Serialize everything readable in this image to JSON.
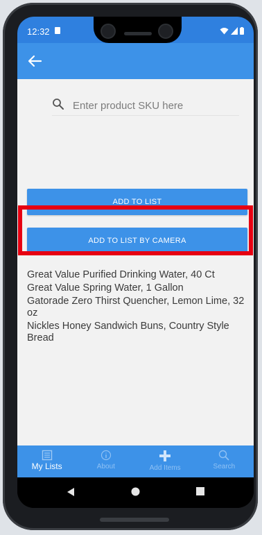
{
  "status": {
    "time": "12:32",
    "icons": [
      "wifi-icon",
      "signal-icon",
      "battery-icon"
    ]
  },
  "appbar": {
    "back_icon": "arrow-left-icon"
  },
  "search": {
    "placeholder": "Enter product SKU here",
    "value": ""
  },
  "buttons": {
    "add_to_list": "ADD TO LIST",
    "add_by_camera": "ADD TO LIST BY CAMERA"
  },
  "list_items": [
    "Great Value Purified Drinking Water, 40 Ct",
    "Great Value Spring Water, 1 Gallon",
    "Gatorade Zero Thirst Quencher, Lemon Lime, 32 oz",
    "Nickles Honey Sandwich Buns, Country Style Bread"
  ],
  "tabs": [
    {
      "label": "My Lists",
      "icon": "list-icon",
      "active": true
    },
    {
      "label": "About",
      "icon": "info-icon",
      "active": false
    },
    {
      "label": "Add Items",
      "icon": "plus-icon",
      "active": false
    },
    {
      "label": "Search",
      "icon": "search-icon",
      "active": false
    }
  ],
  "colors": {
    "primary": "#3d92e8",
    "status_bar": "#2f80df",
    "highlight": "#e60012",
    "background": "#f2f2f2"
  }
}
